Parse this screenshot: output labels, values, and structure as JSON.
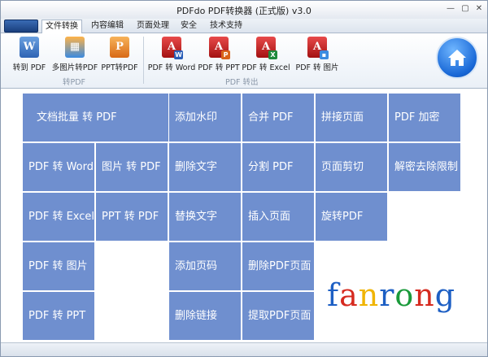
{
  "window": {
    "title": "PDFdo  PDF转换器 (正式版) v3.0",
    "controls": {
      "minimize": "—",
      "maximize": "▢",
      "close": "✕"
    }
  },
  "tabs": [
    "文件转换",
    "内容编辑",
    "页面处理",
    "安全",
    "技术支持"
  ],
  "active_tab": 0,
  "ribbon": {
    "groups": [
      {
        "label": "转PDF",
        "buttons": [
          {
            "label": "转到 PDF",
            "icon": "word-to-pdf-icon"
          },
          {
            "label": "多图片转PDF",
            "icon": "images-to-pdf-icon"
          },
          {
            "label": "PPT转PDF",
            "icon": "ppt-to-pdf-icon"
          }
        ]
      },
      {
        "label": "PDF 转出",
        "buttons": [
          {
            "label": "PDF 转 Word",
            "icon": "pdf-to-word-icon",
            "badge": "W",
            "badge_color": "#2b5fb8"
          },
          {
            "label": "PDF 转 PPT",
            "icon": "pdf-to-ppt-icon",
            "badge": "P",
            "badge_color": "#d9631b"
          },
          {
            "label": "PDF 转 Excel",
            "icon": "pdf-to-excel-icon",
            "badge": "X",
            "badge_color": "#1e8a3c"
          },
          {
            "label": "PDF 转 图片",
            "icon": "pdf-to-image-icon",
            "badge": "▪",
            "badge_color": "#3b8be0"
          }
        ]
      }
    ]
  },
  "home_button": {
    "icon": "home-icon"
  },
  "tiles": {
    "batch": "文档批量 转 PDF",
    "encrypt": "PDF 加密",
    "pdf_word": "PDF 转 Word",
    "img_pdf": "图片 转 PDF",
    "decrypt": "解密去除限制",
    "pdf_excel": "PDF 转 Excel",
    "ppt_pdf": "PPT 转 PDF",
    "pdf_img": "PDF 转 图片",
    "pdf_ppt": "PDF 转 PPT",
    "watermark": "添加水印",
    "del_text": "删除文字",
    "replace_text": "替换文字",
    "page_num": "添加页码",
    "del_link": "删除链接",
    "merge": "合并 PDF",
    "split": "分割 PDF",
    "insert_page": "插入页面",
    "del_page": "删除PDF页面",
    "extract_page": "提取PDF页面",
    "join_page": "拼接页面",
    "crop_page": "页面剪切",
    "rotate": "旋转PDF"
  },
  "logo": {
    "letters": [
      "f",
      "a",
      "n",
      "r",
      "o",
      "n",
      "g"
    ],
    "colors": [
      "#1d5fc4",
      "#d62a1f",
      "#f0b400",
      "#1d5fc4",
      "#1a9a3a",
      "#d62a1f",
      "#1d5fc4"
    ]
  },
  "colors": {
    "tile": "#6f8fcf",
    "accent": "#1867d6"
  }
}
